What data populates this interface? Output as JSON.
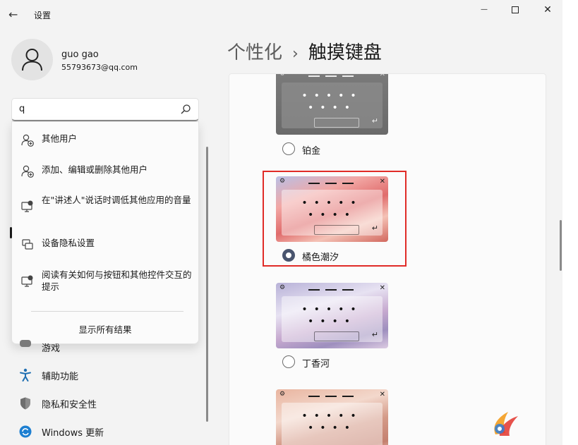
{
  "window": {
    "title": "设置",
    "back_glyph": "←",
    "min_glyph": "—",
    "close_glyph": "✕"
  },
  "profile": {
    "name": "guo gao",
    "email": "55793673@qq.com"
  },
  "search": {
    "value": "q"
  },
  "search_results": [
    {
      "icon": "user-add-icon",
      "label": "其他用户"
    },
    {
      "icon": "user-edit-icon",
      "label": "添加、编辑或删除其他用户"
    },
    {
      "icon": "narrator-monitor-icon",
      "label": "在\"讲述人\"说话时调低其他应用的音量"
    },
    {
      "icon": "privacy-settings-icon",
      "label": "设备隐私设置"
    },
    {
      "icon": "help-monitor-icon",
      "label": "阅读有关如何与按钮和其他控件交互的提示"
    }
  ],
  "show_all_label": "显示所有结果",
  "nav": [
    {
      "icon": "gamepad-icon",
      "label": "游戏"
    },
    {
      "icon": "accessibility-icon",
      "label": "辅助功能"
    },
    {
      "icon": "shield-icon",
      "label": "隐私和安全性"
    },
    {
      "icon": "windows-update-icon",
      "label": "Windows 更新"
    }
  ],
  "header": {
    "parent": "个性化",
    "separator": "›",
    "current": "触摸键盘"
  },
  "themes": [
    {
      "name": "铂金",
      "selected": false
    },
    {
      "name": "橘色潮汐",
      "selected": true
    },
    {
      "name": "丁香河",
      "selected": false
    },
    {
      "name": "",
      "selected": false
    }
  ],
  "keyboard_glyphs": {
    "gear": "⚙",
    "close": "✕",
    "enter": "↵",
    "row1": "•••••",
    "row2": "••••"
  },
  "colors": {
    "accent_radio": "#49546e",
    "highlight_box": "#e02b27"
  }
}
